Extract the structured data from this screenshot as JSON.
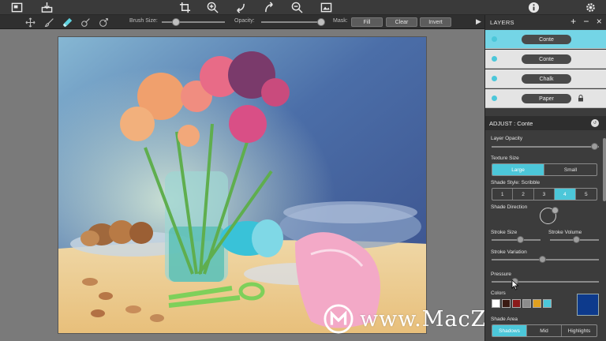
{
  "toolbar": {
    "brush_size_label": "Brush Size:",
    "opacity_label": "Opacity:",
    "mask_label": "Mask:",
    "fill_label": "Fill",
    "clear_label": "Clear",
    "invert_label": "Invert",
    "brush_size_value": 0.22,
    "opacity_value": 0.95
  },
  "layers": {
    "title": "LAYERS",
    "items": [
      {
        "label": "Conte",
        "selected": true,
        "locked": false
      },
      {
        "label": "Conte",
        "selected": false,
        "locked": false
      },
      {
        "label": "Chalk",
        "selected": false,
        "locked": false
      },
      {
        "label": "Paper",
        "selected": false,
        "locked": true
      }
    ]
  },
  "adjust": {
    "title": "ADJUST : Conte",
    "layer_opacity_label": "Layer Opacity",
    "layer_opacity_value": 0.96,
    "texture_size_label": "Texture Size",
    "texture_options": [
      "Large",
      "Small"
    ],
    "texture_selected": "Large",
    "shade_style_label": "Shade Style: Scribble",
    "shade_style_options": [
      "1",
      "2",
      "3",
      "4",
      "5"
    ],
    "shade_style_selected": "4",
    "shade_direction_label": "Shade Direction",
    "stroke_size_label": "Stroke Size",
    "stroke_size_value": 0.6,
    "stroke_volume_label": "Stroke Volume",
    "stroke_volume_value": 0.55,
    "stroke_variation_label": "Stroke Variation",
    "stroke_variation_value": 0.48,
    "pressure_label": "Pressure",
    "pressure_value": 0.22,
    "colors_label": "Colors",
    "swatch_colors": [
      "#ffffff",
      "#3a1a12",
      "#8b1a1a",
      "#8c8c8c",
      "#e0a020",
      "#4cc7d9"
    ],
    "active_color": "#0d3a8c",
    "shade_area_label": "Shade Area",
    "shade_area_options": [
      "Shadows",
      "Mid",
      "Highlights"
    ],
    "shade_area_selected": "Shadows"
  },
  "watermark": {
    "text": "www.MacZ.com"
  },
  "accent_color": "#4cc7d9"
}
